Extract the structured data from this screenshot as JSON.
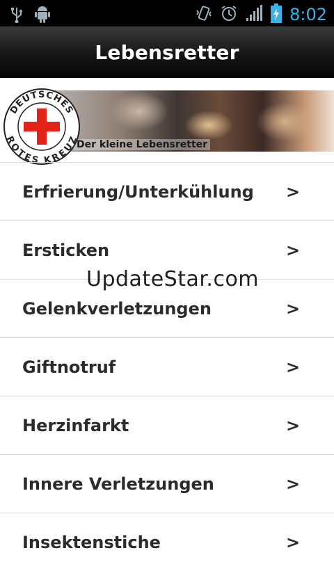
{
  "status_bar": {
    "time": "8:02",
    "icons": [
      "usb-icon",
      "android-debug-icon",
      "vibrate-icon",
      "alarm-icon",
      "signal-icon",
      "battery-charging-icon"
    ],
    "accent": "#39b3e6"
  },
  "header": {
    "title": "Lebensretter"
  },
  "banner": {
    "logo_top_text": "DEUTSCHES",
    "logo_bottom_text": "ROTES KREUZ",
    "caption": "Der kleine Lebensretter"
  },
  "menu": {
    "items": [
      {
        "label": "Erfrierung/Unterkühlung",
        "arrow": ">"
      },
      {
        "label": "Ersticken",
        "arrow": ">"
      },
      {
        "label": "Gelenkverletzungen",
        "arrow": ">"
      },
      {
        "label": "Giftnotruf",
        "arrow": ">"
      },
      {
        "label": "Herzinfarkt",
        "arrow": ">"
      },
      {
        "label": "Innere Verletzungen",
        "arrow": ">"
      },
      {
        "label": "Insektenstiche",
        "arrow": ">"
      }
    ]
  },
  "watermark": "UpdateStar.com",
  "colors": {
    "red_cross": "#e2231a",
    "divider": "#d8d8d8"
  }
}
